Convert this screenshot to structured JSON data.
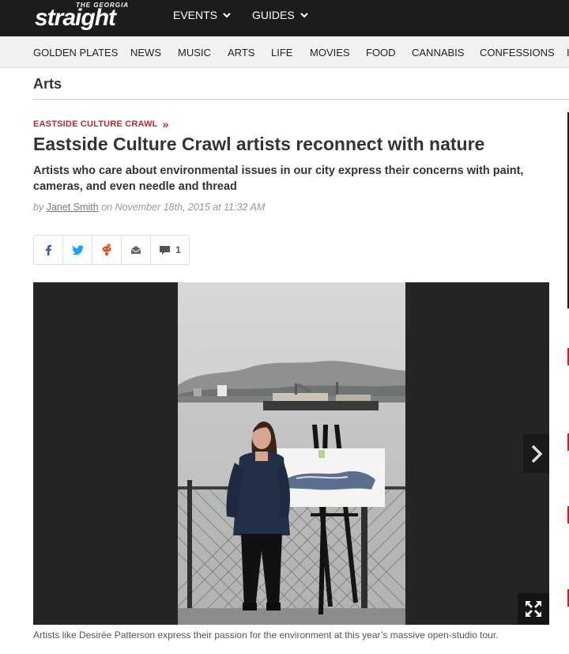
{
  "logo": {
    "small": "THE GEORGIA",
    "main": "straight"
  },
  "topnav": [
    {
      "label": "EVENTS"
    },
    {
      "label": "GUIDES"
    }
  ],
  "categories": [
    "GOLDEN PLATES",
    "NEWS",
    "MUSIC",
    "ARTS",
    "LIFE",
    "MOVIES",
    "FOOD",
    "CANNABIS",
    "CONFESSIONS",
    "I"
  ],
  "section_title": "Arts",
  "article": {
    "kicker": "EASTSIDE CULTURE CRAWL",
    "kicker_arrow": "»",
    "headline": "Eastside Culture Crawl artists reconnect with nature",
    "dek": "Artists who care about environmental issues in our city express their concerns with paint, cameras, and even needle and thread",
    "byline": {
      "by": "by",
      "author": "Janet Smith",
      "on": "on November 18th, 2015 at 11:32 AM"
    }
  },
  "share": {
    "icons": [
      "facebook-icon",
      "twitter-icon",
      "reddit-icon",
      "email-icon",
      "comment-icon"
    ],
    "comment_count": "1"
  },
  "gallery": {
    "caption": "Artists like Desirée Patterson express their passion for the environment at this year’s massive open-studio tour."
  },
  "colors": {
    "topbar": "#1c1c1c",
    "accent_red": "#c0272d",
    "facebook": "#3b5998",
    "twitter": "#1da1f2",
    "reddit": "#ff4500"
  }
}
